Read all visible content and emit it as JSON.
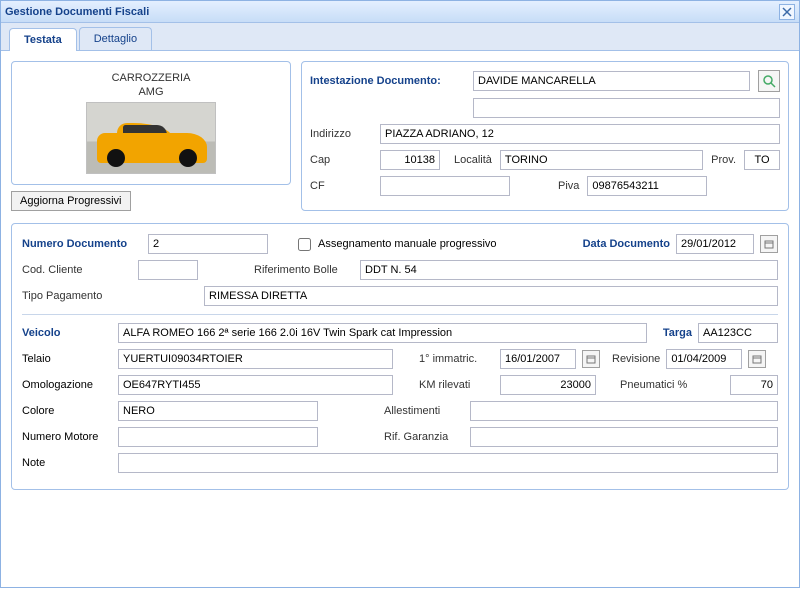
{
  "window": {
    "title": "Gestione Documenti Fiscali"
  },
  "tabs": {
    "t1": "Testata",
    "t2": "Dettaglio"
  },
  "company": {
    "line1": "CARROZZERIA",
    "line2": "AMG"
  },
  "buttons": {
    "aggiorna": "Aggiorna Progressivi"
  },
  "intest": {
    "label": "Intestazione Documento:",
    "name": "DAVIDE MANCARELLA",
    "extra": "",
    "indirizzo_lbl": "Indirizzo",
    "indirizzo": "PIAZZA ADRIANO, 12",
    "cap_lbl": "Cap",
    "cap": "10138",
    "localita_lbl": "Località",
    "localita": "TORINO",
    "prov_lbl": "Prov.",
    "prov": "TO",
    "cf_lbl": "CF",
    "cf": "",
    "piva_lbl": "Piva",
    "piva": "09876543211"
  },
  "doc": {
    "numero_lbl": "Numero Documento",
    "numero": "2",
    "assegnamento_lbl": "Assegnamento manuale progressivo",
    "data_lbl": "Data Documento",
    "data": "29/01/2012",
    "codcliente_lbl": "Cod. Cliente",
    "codcliente": "",
    "rifbolle_lbl": "Riferimento Bolle",
    "rifbolle": "DDT N. 54",
    "tipopag_lbl": "Tipo Pagamento",
    "tipopag": "RIMESSA DIRETTA"
  },
  "veicolo": {
    "veicolo_lbl": "Veicolo",
    "veicolo": "ALFA ROMEO 166 2ª serie 166 2.0i 16V Twin Spark cat Impression",
    "targa_lbl": "Targa",
    "targa": "AA123CC",
    "telaio_lbl": "Telaio",
    "telaio": "YUERTUI09034RTOIER",
    "immatric_lbl": "1° immatric.",
    "immatric": "16/01/2007",
    "revisione_lbl": "Revisione",
    "revisione": "01/04/2009",
    "omolog_lbl": "Omologazione",
    "omolog": "OE647RYTI455",
    "km_lbl": "KM rilevati",
    "km": "23000",
    "pneu_lbl": "Pneumatici %",
    "pneu": "70",
    "colore_lbl": "Colore",
    "colore": "NERO",
    "allest_lbl": "Allestimenti",
    "allest": "",
    "motore_lbl": "Numero Motore",
    "motore": "",
    "garanzia_lbl": "Rif. Garanzia",
    "garanzia": "",
    "note_lbl": "Note",
    "note": ""
  }
}
